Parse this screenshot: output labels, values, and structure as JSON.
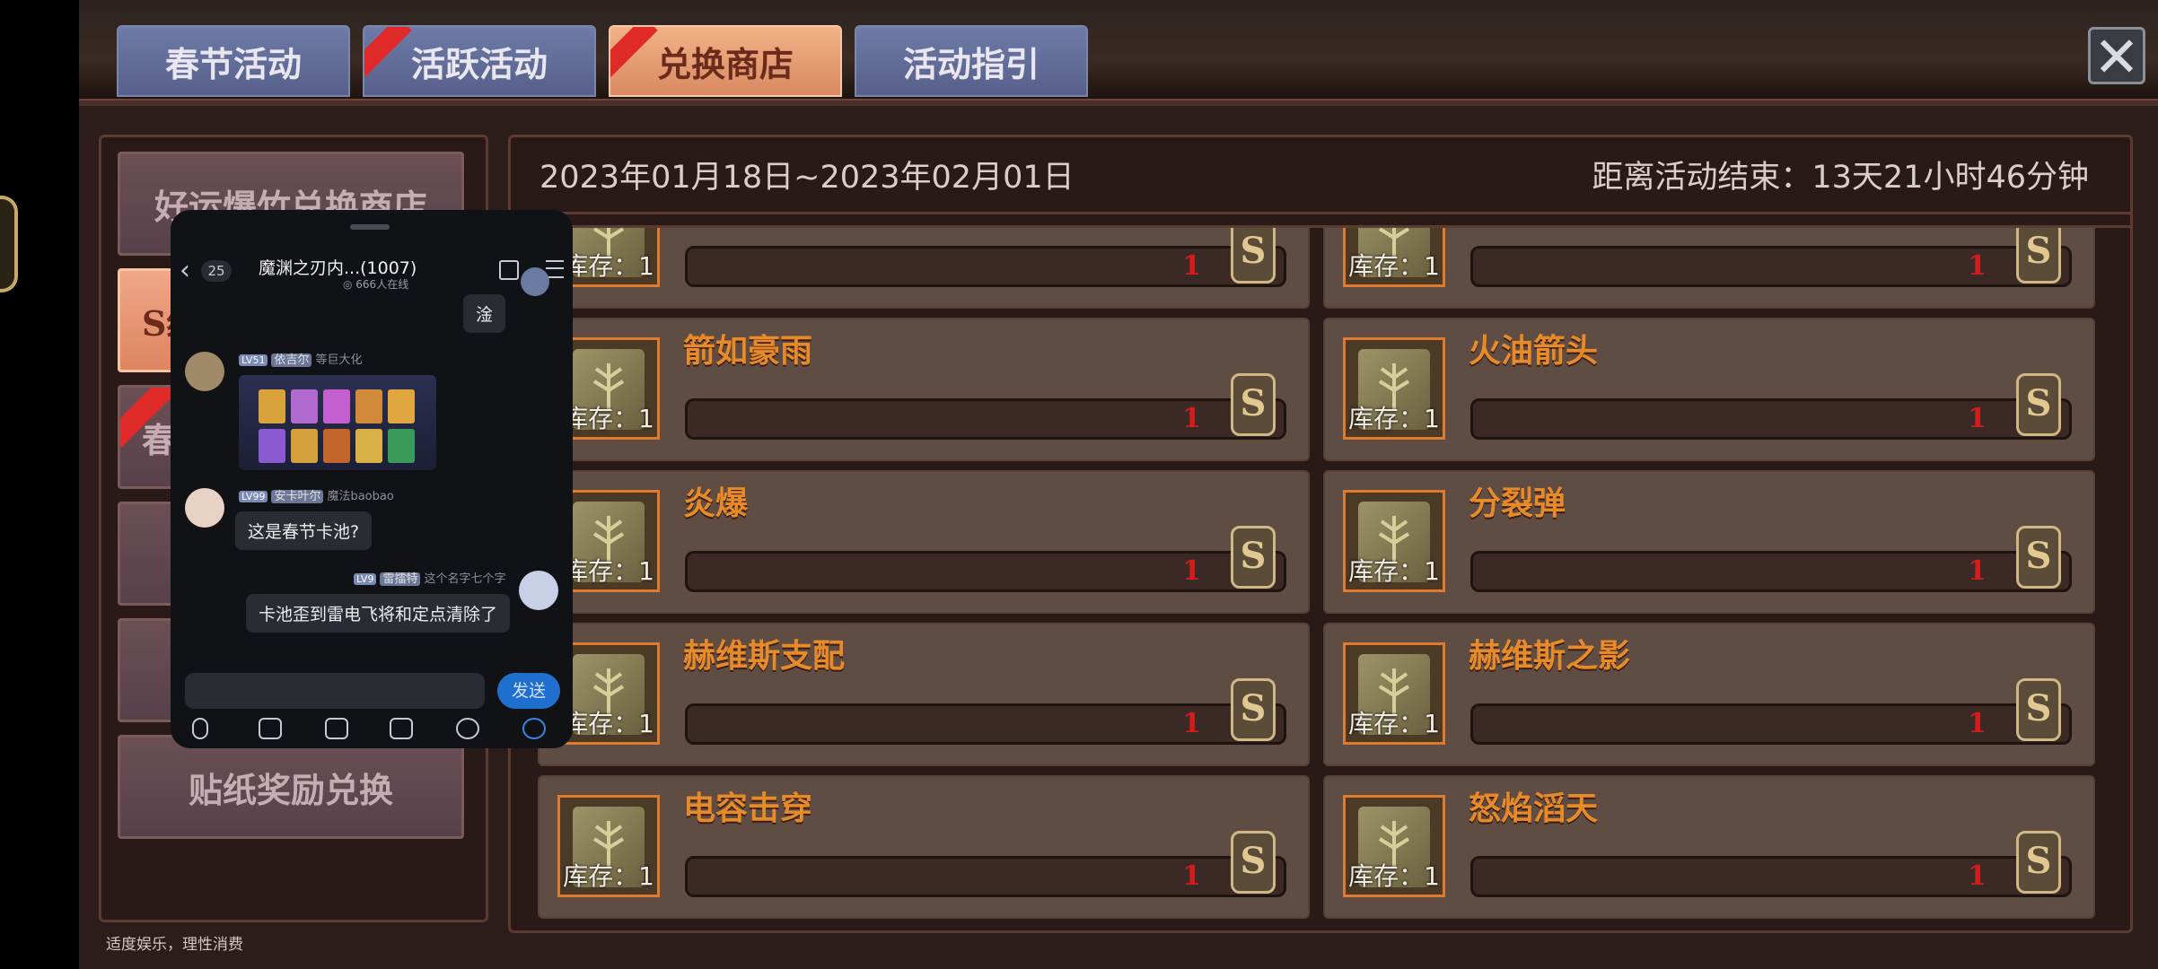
{
  "tabs": [
    {
      "label": "春节活动",
      "active": false,
      "ribbon": false
    },
    {
      "label": "活跃活动",
      "active": false,
      "ribbon": true
    },
    {
      "label": "兑换商店",
      "active": true,
      "ribbon": true
    },
    {
      "label": "活动指引",
      "active": false,
      "ribbon": false
    }
  ],
  "close_label": "✕",
  "sidebar": {
    "items": [
      {
        "label": "好运爆竹兑换商店"
      },
      {
        "label": "S级"
      },
      {
        "label": "春"
      },
      {
        "label": ""
      },
      {
        "label": ""
      },
      {
        "label": "贴纸奖励兑换"
      }
    ]
  },
  "footer_note": "适度娱乐，理性消费",
  "header": {
    "date_range": "2023年01月18日~2023年02月01日",
    "countdown": "距离活动结束：13天21小时46分钟"
  },
  "items": [
    {
      "title": "",
      "stock": "库存：1",
      "count": "1"
    },
    {
      "title": "",
      "stock": "库存：1",
      "count": "1"
    },
    {
      "title": "箭如豪雨",
      "stock": "库存：1",
      "count": "1"
    },
    {
      "title": "火油箭头",
      "stock": "库存：1",
      "count": "1"
    },
    {
      "title": "炎爆",
      "stock": "库存：1",
      "count": "1"
    },
    {
      "title": "分裂弹",
      "stock": "库存：1",
      "count": "1"
    },
    {
      "title": "赫维斯支配",
      "stock": "库存：1",
      "count": "1"
    },
    {
      "title": "赫维斯之影",
      "stock": "库存：1",
      "count": "1"
    },
    {
      "title": "电容击穿",
      "stock": "库存：1",
      "count": "1"
    },
    {
      "title": "怒焰滔天",
      "stock": "库存：1",
      "count": "1"
    }
  ],
  "coin_glyph": "S",
  "chat": {
    "unread": "25",
    "title": "魔渊之刃内...(1007)",
    "online": "◎ 666人在线",
    "messages": [
      {
        "text": "淦"
      },
      {
        "level": "LV51",
        "name": "依吉尔",
        "tag": "等巨大化"
      },
      {
        "level": "LV99",
        "name": "安卡叶尔",
        "tag": "魔法baobao",
        "text": "这是春节卡池?"
      },
      {
        "level": "LV9",
        "name": "雷擂特",
        "tag": "这个名字七个字",
        "text": "卡池歪到雷电飞将和定点清除了"
      }
    ],
    "send_label": "发送"
  }
}
